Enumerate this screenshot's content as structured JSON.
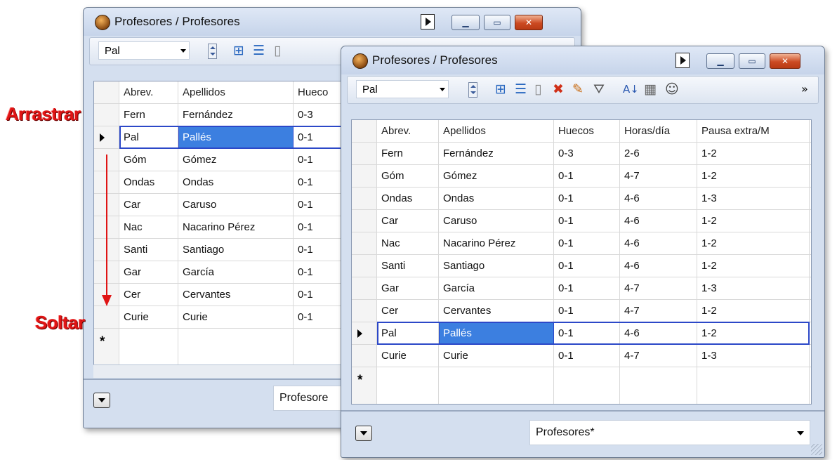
{
  "annotations": {
    "drag": "Arrastrar",
    "drop": "Soltar"
  },
  "back_window": {
    "title": "Profesores / Profesores",
    "combo_value": "Pal",
    "columns": [
      "Abrev.",
      "Apellidos",
      "Hueco"
    ],
    "rows": [
      [
        "Fern",
        "Fernández",
        "0-3"
      ],
      [
        "Pal",
        "Pallés",
        "0-1"
      ],
      [
        "Góm",
        "Gómez",
        "0-1"
      ],
      [
        "Ondas",
        "Ondas",
        "0-1"
      ],
      [
        "Car",
        "Caruso",
        "0-1"
      ],
      [
        "Nac",
        "Nacarino Pérez",
        "0-1"
      ],
      [
        "Santi",
        "Santiago",
        "0-1"
      ],
      [
        "Gar",
        "García",
        "0-1"
      ],
      [
        "Cer",
        "Cervantes",
        "0-1"
      ],
      [
        "Curie",
        "Curie",
        "0-1"
      ]
    ],
    "new_row_marker": "*",
    "view_value": "Profesore"
  },
  "front_window": {
    "title": "Profesores / Profesores",
    "combo_value": "Pal",
    "overflow_label": "»",
    "columns": [
      "Abrev.",
      "Apellidos",
      "Huecos",
      "Horas/día",
      "Pausa extra/M"
    ],
    "rows": [
      [
        "Fern",
        "Fernández",
        "0-3",
        "2-6",
        "1-2"
      ],
      [
        "Góm",
        "Gómez",
        "0-1",
        "4-7",
        "1-2"
      ],
      [
        "Ondas",
        "Ondas",
        "0-1",
        "4-6",
        "1-3"
      ],
      [
        "Car",
        "Caruso",
        "0-1",
        "4-6",
        "1-2"
      ],
      [
        "Nac",
        "Nacarino Pérez",
        "0-1",
        "4-6",
        "1-2"
      ],
      [
        "Santi",
        "Santiago",
        "0-1",
        "4-6",
        "1-2"
      ],
      [
        "Gar",
        "García",
        "0-1",
        "4-7",
        "1-3"
      ],
      [
        "Cer",
        "Cervantes",
        "0-1",
        "4-7",
        "1-2"
      ],
      [
        "Pal",
        "Pallés",
        "0-1",
        "4-6",
        "1-2"
      ],
      [
        "Curie",
        "Curie",
        "0-1",
        "4-7",
        "1-3"
      ]
    ],
    "new_row_marker": "*",
    "view_value": "Profesores*"
  },
  "icons": [
    "app-clock-icon",
    "play-icon",
    "minimize-icon",
    "maximize-icon",
    "close-icon",
    "spin-icon",
    "grid-expand-icon",
    "row-list-icon",
    "new-record-icon",
    "delete-icon",
    "edit-icon",
    "filter-icon",
    "sort-az-icon",
    "columns-icon",
    "users-icon",
    "overflow-icon",
    "dropdown-icon",
    "resize-grip-icon",
    "drag-arrow-icon"
  ],
  "colors": {
    "selection": "#3c7fe0",
    "selection_frame": "#2c48c8",
    "annotation": "#e01414",
    "window": "#d4dfef"
  }
}
